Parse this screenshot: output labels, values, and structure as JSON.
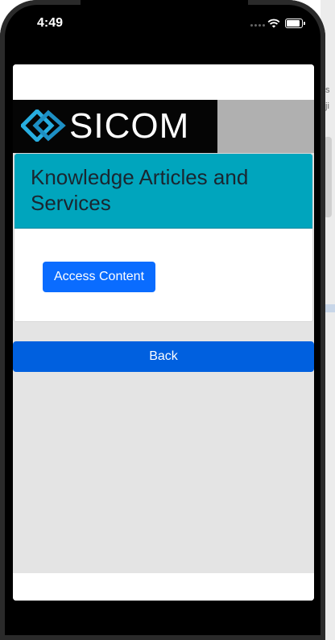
{
  "status_bar": {
    "time": "4:49",
    "icons": [
      "signal-dots-icon",
      "wifi-icon",
      "battery-icon"
    ]
  },
  "logo": {
    "text": "SICOM",
    "mark_icon": "sicom-diamond-logo-icon",
    "mark_color": "#27aee0"
  },
  "card": {
    "title": "Knowledge Articles and Services",
    "access_button_label": "Access Content"
  },
  "back_button_label": "Back",
  "background_fragments": [
    "s",
    "ji"
  ],
  "colors": {
    "header_teal": "#00a5bd",
    "button_blue": "#0a6cff",
    "back_blue": "#0060df",
    "app_background": "#e4e4e4"
  }
}
